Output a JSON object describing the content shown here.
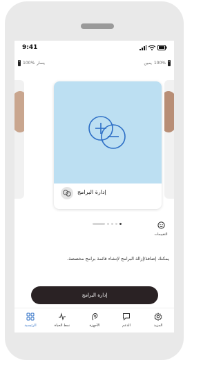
{
  "status_bar": {
    "time": "9:41"
  },
  "battery": {
    "left": {
      "label": "يسار",
      "percent": "100%"
    },
    "right": {
      "label": "يمين",
      "percent": "100%"
    }
  },
  "card": {
    "title": "إدارة البرامج"
  },
  "ratings": {
    "label": "التقييمات"
  },
  "description": "يمكنك إضافة/إزالة البرامج لإنشاء قائمة برامج مخصصة.",
  "cta": {
    "label": "إدارة البرامج"
  },
  "tabs": [
    {
      "label": "الرئيسية",
      "icon": "home-icon"
    },
    {
      "label": "نمط الحياة",
      "icon": "activity-icon"
    },
    {
      "label": "الأجهزة",
      "icon": "hearing-aid-icon"
    },
    {
      "label": "الدعم",
      "icon": "chat-icon"
    },
    {
      "label": "المزيد",
      "icon": "gear-icon"
    }
  ],
  "colors": {
    "accent": "#2d6fc6",
    "card_bg": "#bcdff2",
    "button_bg": "#2a2224"
  }
}
